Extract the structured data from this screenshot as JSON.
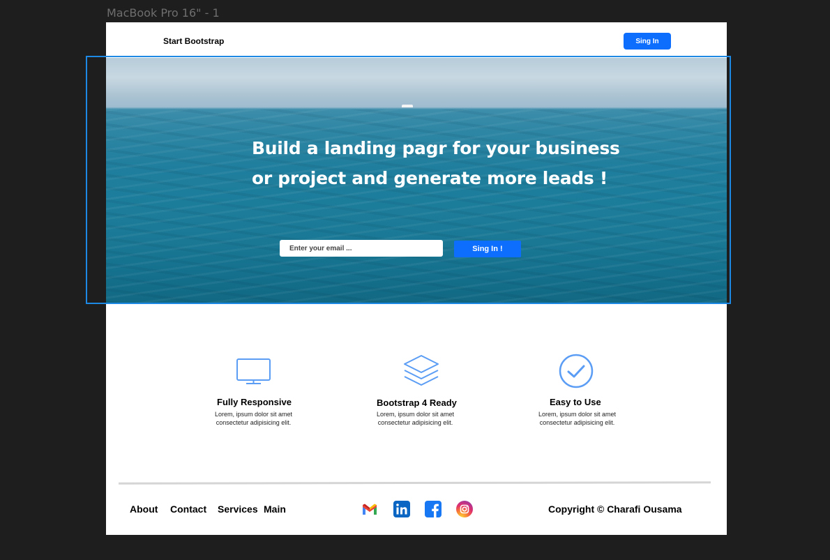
{
  "frame_label": "MacBook Pro 16\" - 1",
  "navbar": {
    "brand": "Start Bootstrap",
    "signin_label": "Sing In"
  },
  "hero": {
    "title_line1": "Build a landing pagr for your business",
    "title_line2": "or project and generate more leads !",
    "email_placeholder": "Enter your email ...",
    "signin_label": "Sing In !"
  },
  "features": [
    {
      "icon": "monitor-icon",
      "title": "Fully Responsive",
      "desc_line1": "Lorem, ipsum dolor sit amet",
      "desc_line2": "consectetur adipisicing elit."
    },
    {
      "icon": "layers-icon",
      "title": "Bootstrap 4 Ready",
      "desc_line1": "Lorem, ipsum dolor sit amet",
      "desc_line2": "consectetur adipisicing elit."
    },
    {
      "icon": "check-circle-icon",
      "title": "Easy to Use",
      "desc_line1": "Lorem, ipsum dolor sit amet",
      "desc_line2": "consectetur adipisicing elit."
    }
  ],
  "footer": {
    "links": [
      "About",
      "Contact",
      "Services",
      "Main"
    ],
    "social": [
      "gmail-icon",
      "linkedin-icon",
      "facebook-icon",
      "instagram-icon"
    ],
    "copyright": "Copyright © Charafi Ousama"
  },
  "colors": {
    "accent": "#0d6efd",
    "icon_blue": "#5b9df5",
    "canvas": "#1e1e1e",
    "selection": "#1e88e5"
  }
}
